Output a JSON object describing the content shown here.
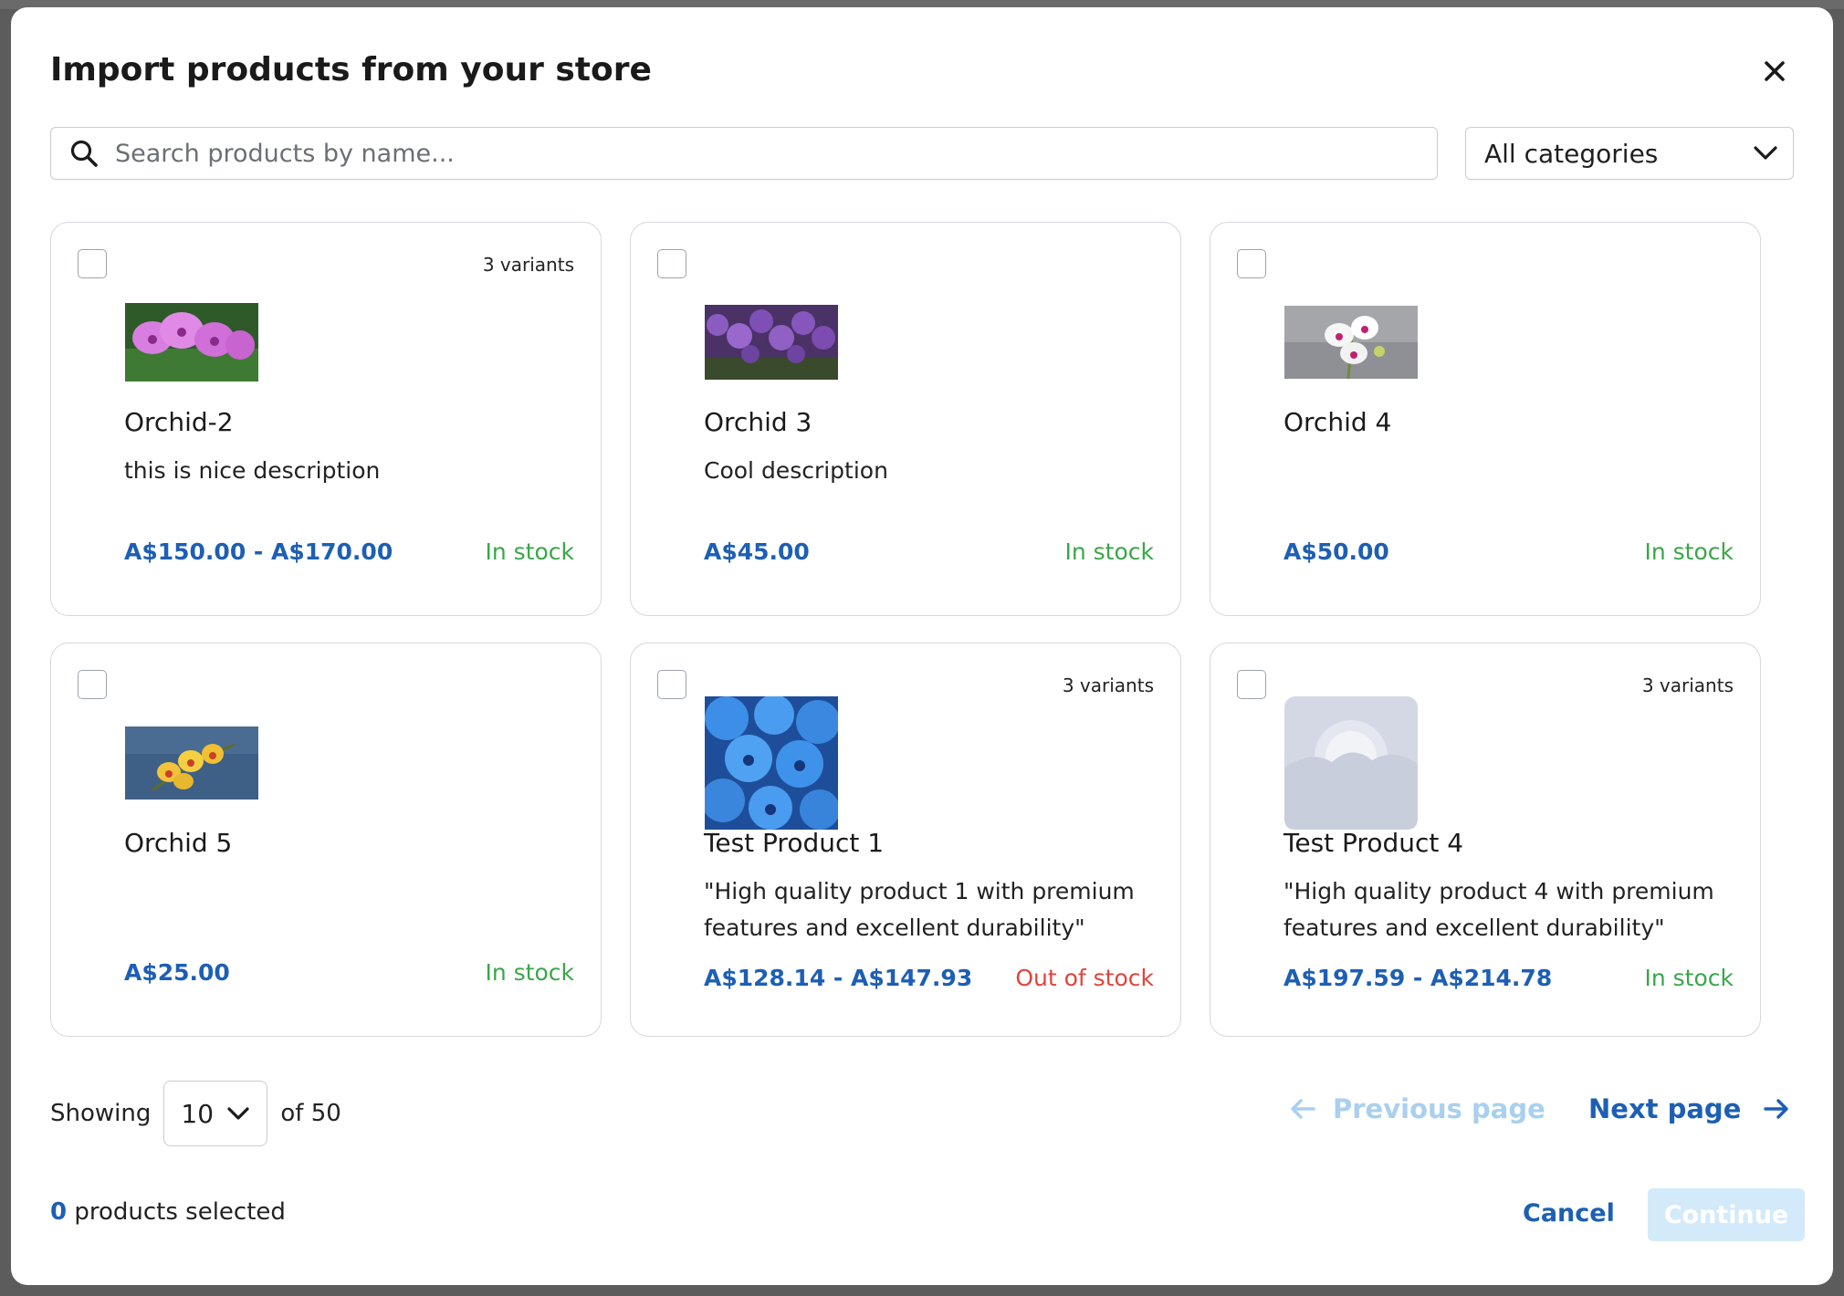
{
  "modal": {
    "title": "Import products from your store"
  },
  "search": {
    "placeholder": "Search products by name..."
  },
  "category_filter": {
    "selected": "All categories"
  },
  "products": [
    {
      "name": "Orchid-2",
      "description": "this is nice description",
      "price": "A$150.00 - A$170.00",
      "stock": "In stock",
      "variants": "3 variants",
      "image": "pink-orchid-photo",
      "checked": false
    },
    {
      "name": "Orchid 3",
      "description": "Cool description",
      "price": "A$45.00",
      "stock": "In stock",
      "variants": "",
      "image": "purple-orchid-photo",
      "checked": false
    },
    {
      "name": "Orchid 4",
      "description": "",
      "price": "A$50.00",
      "stock": "In stock",
      "variants": "",
      "image": "white-orchid-photo",
      "checked": false
    },
    {
      "name": "Orchid 5",
      "description": "",
      "price": "A$25.00",
      "stock": "In stock",
      "variants": "",
      "image": "yellow-orchid-photo",
      "checked": false
    },
    {
      "name": "Test Product 1",
      "description": "\"High quality product 1 with premium features and excellent durability\"",
      "price": "A$128.14 - A$147.93",
      "stock": "Out of stock",
      "variants": "3 variants",
      "image": "blue-orchid-photo",
      "checked": false
    },
    {
      "name": "Test Product 4",
      "description": "\"High quality product 4 with premium features and excellent durability\"",
      "price": "A$197.59 - A$214.78",
      "stock": "In stock",
      "variants": "3 variants",
      "image": "image-placeholder",
      "checked": false
    }
  ],
  "pagination": {
    "showing_label": "Showing",
    "page_size": "10",
    "total_label": "of 50",
    "prev_label": "Previous page",
    "next_label": "Next page"
  },
  "footer": {
    "selected_count": "0",
    "selected_label": "products selected",
    "cancel_label": "Cancel",
    "continue_label": "Continue"
  },
  "colors": {
    "accent": "#1d5fb4",
    "in_stock": "#3aa64a",
    "out_of_stock": "#e0433c",
    "disabled_button": "#d3eafb"
  }
}
